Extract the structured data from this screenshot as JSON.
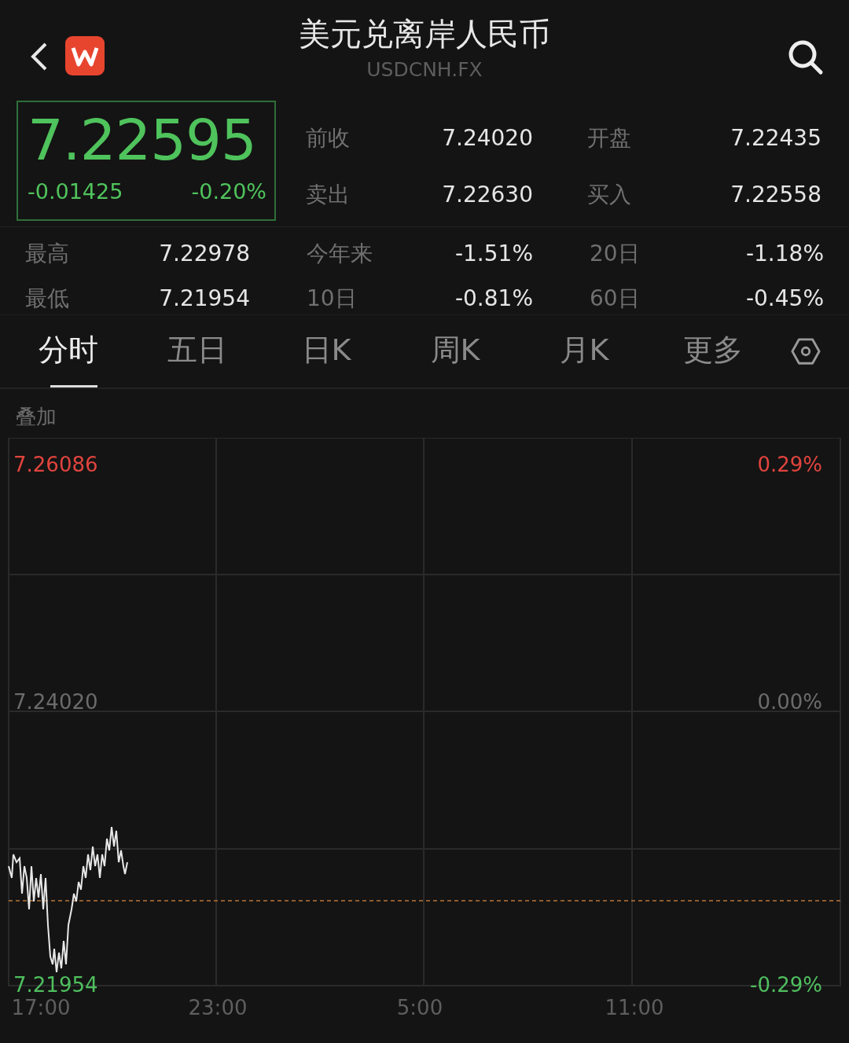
{
  "header": {
    "title": "美元兑离岸人民币",
    "subtitle": "USDCNH.FX"
  },
  "quote": {
    "price": "7.22595",
    "change": "-0.01425",
    "change_pct": "-0.20%"
  },
  "quote_stats": [
    {
      "label": "前收",
      "value": "7.24020"
    },
    {
      "label": "开盘",
      "value": "7.22435"
    },
    {
      "label": "卖出",
      "value": "7.22630"
    },
    {
      "label": "买入",
      "value": "7.22558"
    }
  ],
  "range_stats": [
    {
      "label": "最高",
      "value": "7.22978"
    },
    {
      "label": "今年来",
      "value": "-1.51%"
    },
    {
      "label": "20日",
      "value": "-1.18%"
    },
    {
      "label": "最低",
      "value": "7.21954"
    },
    {
      "label": "10日",
      "value": "-0.81%"
    },
    {
      "label": "60日",
      "value": "-0.45%"
    }
  ],
  "tabs": [
    {
      "label": "分时",
      "selected": true
    },
    {
      "label": "五日",
      "selected": false
    },
    {
      "label": "日K",
      "selected": false
    },
    {
      "label": "周K",
      "selected": false
    },
    {
      "label": "月K",
      "selected": false
    },
    {
      "label": "更多",
      "selected": false
    }
  ],
  "chart": {
    "overlay_label": "叠加",
    "price_labels": [
      {
        "text": "7.26086",
        "color": "#e0443e"
      },
      {
        "text": "7.24020",
        "color": "#6b6b6b"
      },
      {
        "text": "7.21954",
        "color": "#4fbf5f"
      }
    ],
    "pct_labels": [
      {
        "text": "0.29%",
        "color": "#e0443e"
      },
      {
        "text": "0.00%",
        "color": "#6b6b6b"
      },
      {
        "text": "-0.29%",
        "color": "#4fbf5f"
      }
    ],
    "time_labels": [
      "17:00",
      "23:00",
      "5:00",
      "11:00"
    ]
  }
}
